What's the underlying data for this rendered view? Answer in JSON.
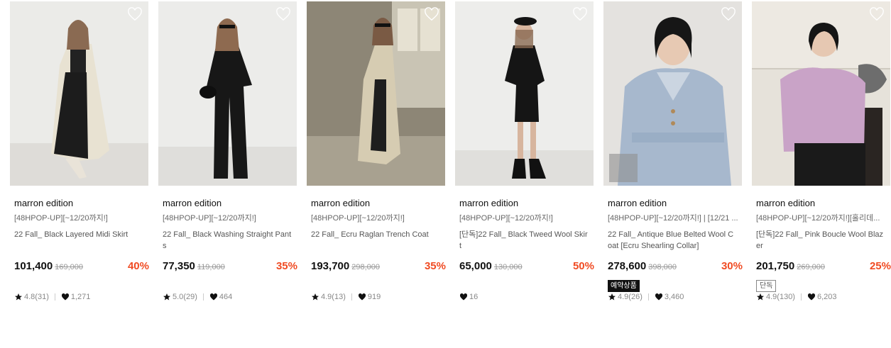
{
  "products": [
    {
      "brand": "marron edition",
      "tag": "[48HPOP-UP][~12/20까지!]",
      "title": "22 Fall_ Black Layered Midi Skirt",
      "price": "101,400",
      "original": "169,000",
      "discount": "40%",
      "badge": "",
      "rating": "4.8(31)",
      "likes": "1,271"
    },
    {
      "brand": "marron edition",
      "tag": "[48HPOP-UP][~12/20까지!]",
      "title": "22 Fall_ Black Washing Straight Pants",
      "price": "77,350",
      "original": "119,000",
      "discount": "35%",
      "badge": "",
      "rating": "5.0(29)",
      "likes": "464"
    },
    {
      "brand": "marron edition",
      "tag": "[48HPOP-UP][~12/20까지!]",
      "title": "22 Fall_ Ecru Raglan Trench Coat",
      "price": "193,700",
      "original": "298,000",
      "discount": "35%",
      "badge": "",
      "rating": "4.9(13)",
      "likes": "919"
    },
    {
      "brand": "marron edition",
      "tag": "[48HPOP-UP][~12/20까지!]",
      "title": "[단독]22 Fall_ Black Tweed Wool Skirt",
      "price": "65,000",
      "original": "130,000",
      "discount": "50%",
      "badge": "",
      "rating": "",
      "likes": "16"
    },
    {
      "brand": "marron edition",
      "tag": "[48HPOP-UP][~12/20까지!] | [12/21 ...",
      "title": "22 Fall_ Antique Blue Belted Wool Coat [Ecru Shearling Collar]",
      "price": "278,600",
      "original": "398,000",
      "discount": "30%",
      "badge": "예약상품",
      "badge_style": "dark",
      "rating": "4.9(26)",
      "likes": "3,460"
    },
    {
      "brand": "marron edition",
      "tag": "[48HPOP-UP][~12/20까지!][홀리데...",
      "title": "[단독]22 Fall_ Pink Boucle Wool Blazer",
      "price": "201,750",
      "original": "269,000",
      "discount": "25%",
      "badge": "단독",
      "badge_style": "outline",
      "rating": "4.9(130)",
      "likes": "6,203"
    }
  ],
  "icons": {
    "wishlist": "heart-outline-icon",
    "rating": "star-icon",
    "likes": "heart-filled-icon"
  },
  "colors": {
    "discount": "#f04b23",
    "text": "#111111",
    "muted": "#888888"
  }
}
